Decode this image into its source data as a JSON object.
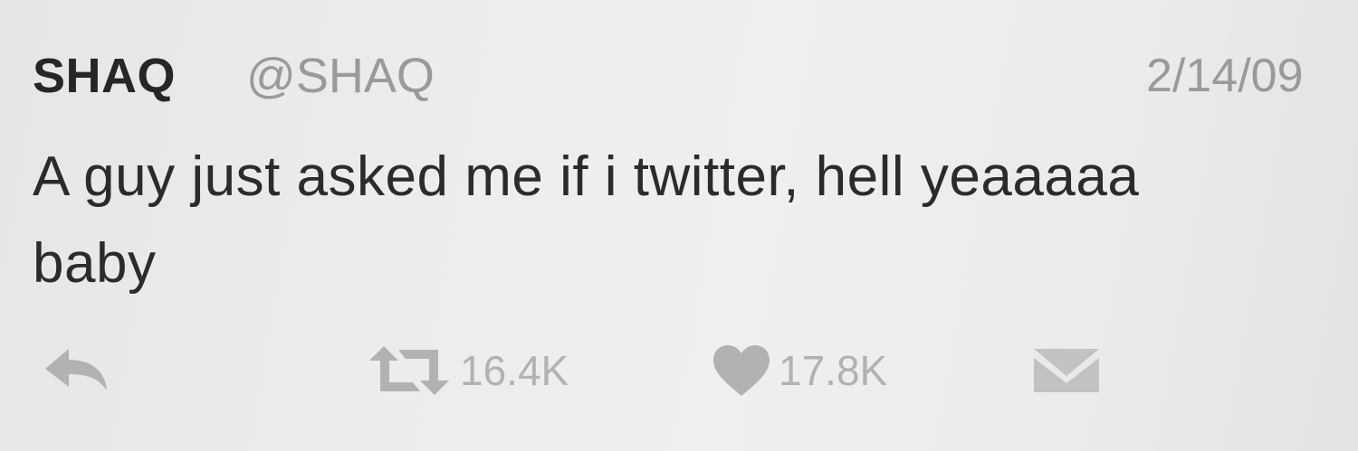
{
  "tweet": {
    "display_name": "SHAQ",
    "handle": "@SHAQ",
    "date": "2/14/09",
    "text": "A guy just asked me if i twitter, hell yeaaaaa baby"
  },
  "actions": {
    "reply_icon": "reply-icon",
    "retweet_icon": "retweet-icon",
    "retweet_count": "16.4K",
    "like_icon": "heart-icon",
    "like_count": "17.8K",
    "message_icon": "envelope-icon"
  },
  "colors": {
    "name": "#262626",
    "muted": "#9a9a9a",
    "icon": "#b2b2b2",
    "text": "#2b2b2b"
  }
}
